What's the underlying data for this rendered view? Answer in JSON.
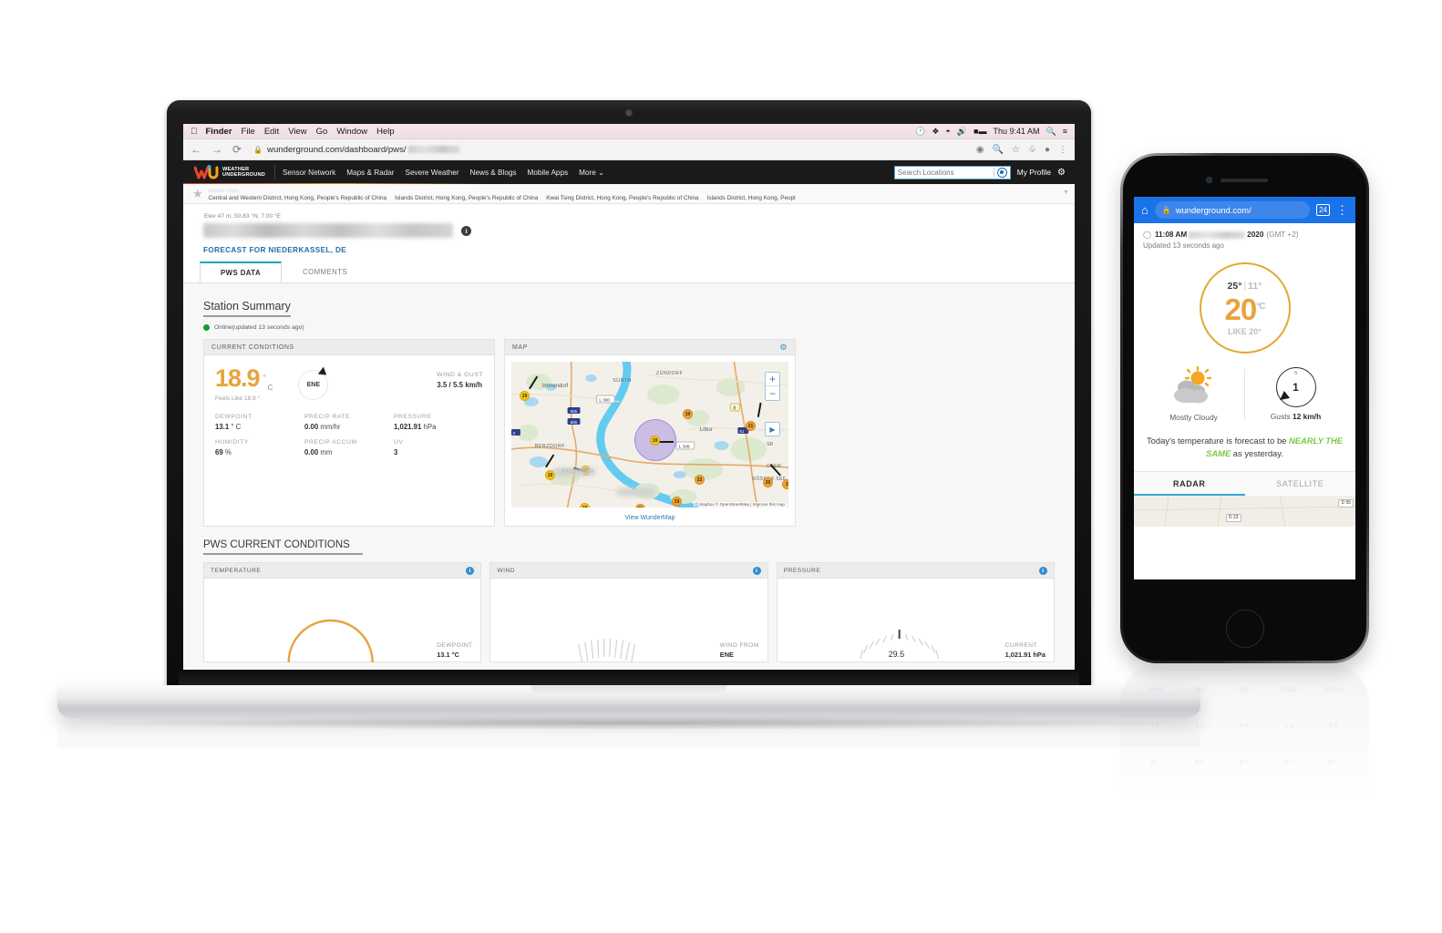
{
  "desktop": {
    "menubar": {
      "apple_icon": "apple-icon",
      "items": [
        "Finder",
        "File",
        "Edit",
        "View",
        "Go",
        "Window",
        "Help"
      ],
      "status_icons": [
        "timemachine-icon",
        "bluetooth-icon",
        "wifi-icon",
        "volume-icon",
        "battery-icon"
      ],
      "clock": "Thu 9:41 AM",
      "search_icon": "spotlight-search-icon",
      "control_center_icon": "control-center-icon"
    },
    "browser": {
      "back_icon": "back-arrow-icon",
      "forward_icon": "forward-arrow-icon",
      "reload_icon": "reload-icon",
      "lock_icon": "lock-icon",
      "url": "wunderground.com/dashboard/pws/",
      "url_redacted": true,
      "toolbar_icons": [
        "install-icon",
        "zoom-search-icon",
        "bookmark-star-icon",
        "extensions-puzzle-icon",
        "profile-avatar-icon",
        "chrome-menu-icon"
      ]
    }
  },
  "site_header": {
    "brand_line1": "WEATHER",
    "brand_line2": "UNDERGROUND",
    "nav": [
      "Sensor Network",
      "Maps & Radar",
      "Severe Weather",
      "News & Blogs",
      "Mobile Apps",
      "More"
    ],
    "more_caret": "chevron-down-icon",
    "search_placeholder": "Search Locations",
    "geolocate_icon": "crosshair-target-icon",
    "my_profile": "My Profile",
    "settings_icon": "gear-icon"
  },
  "recent_cities": {
    "star_icon": "star-icon",
    "label": "Recent Cities",
    "items": [
      "Central and Western District, Hong Kong, People's Republic of China",
      "Islands District, Hong Kong, People's Republic of China",
      "Kwai Tsing District, Hong Kong, People's Republic of China",
      "Islands District, Hong Kong, Peopl"
    ],
    "caret_icon": "chevron-down-icon"
  },
  "station": {
    "elevation": "Elev 47 m, 50.83 °N, 7.00 °E",
    "name_redacted": true,
    "info_icon": "info-icon",
    "forecast_link": "FORECAST FOR NIEDERKASSEL, DE",
    "tabs": [
      {
        "label": "PWS DATA",
        "active": true
      },
      {
        "label": "COMMENTS",
        "active": false
      }
    ]
  },
  "station_summary": {
    "title": "Station Summary",
    "status": "Online(updated 13 seconds ago)",
    "status_color": "#149e28"
  },
  "current_conditions": {
    "header": "CURRENT CONDITIONS",
    "temperature": "18.9",
    "degree_symbol": "°",
    "unit": "C",
    "feels_like": "Feels Like 18.9 °",
    "wind_dir": "ENE",
    "wind_arrow_icon": "wind-direction-arrow-icon",
    "wind_gust_label": "WIND & GUST",
    "wind_gust_value": "3.5  / 5.5 km/h",
    "metrics": [
      {
        "label": "DEWPOINT",
        "value": "13.1",
        "unit": "° C"
      },
      {
        "label": "PRECIP RATE",
        "value": "0.00",
        "unit": "mm/hr"
      },
      {
        "label": "PRESSURE",
        "value": "1,021.91",
        "unit": "hPa"
      },
      {
        "label": "HUMIDITY",
        "value": "69",
        "unit": "%"
      },
      {
        "label": "PRECIP ACCUM",
        "value": "0.00",
        "unit": "mm"
      },
      {
        "label": "UV",
        "value": "3",
        "unit": ""
      }
    ]
  },
  "map_card": {
    "header": "MAP",
    "settings_icon": "gear-icon",
    "zoom_in": "+",
    "zoom_out": "−",
    "play_icon": "play-icon",
    "attribution": "© Mapbox © OpenStreetMap | Improve this map",
    "footer_link": "View WunderMap",
    "place_labels": [
      "Immendorf",
      "SÜRTH",
      "ZÜNDORF",
      "Libur",
      "BERZDORF",
      "KELDENICH",
      "OBER",
      "RÖSRER SEE"
    ],
    "road_shields": [
      "L 300",
      "555",
      "555",
      "8",
      "L 349",
      "51",
      "3"
    ],
    "station_markers": [
      "19",
      "19",
      "19",
      "21",
      "19",
      "19",
      "22",
      "19",
      "20",
      "19",
      "21",
      "19"
    ],
    "selected_marker": "19"
  },
  "pws_conditions": {
    "title": "PWS CURRENT CONDITIONS",
    "cards": [
      {
        "header": "TEMPERATURE",
        "info_icon": "info-icon",
        "side_label": "DEWPOINT",
        "side_value": "13.1 °C"
      },
      {
        "header": "WIND",
        "info_icon": "info-icon",
        "side_label": "WIND FROM",
        "side_value": "ENE",
        "gauge_value": ""
      },
      {
        "header": "PRESSURE",
        "info_icon": "info-icon",
        "side_label": "CURRENT",
        "side_value": "1,021.91 hPa",
        "gauge_value": "29.5"
      }
    ]
  },
  "phone": {
    "browser": {
      "home_icon": "home-icon",
      "lock_icon": "lock-icon",
      "url": "wunderground.com/",
      "tab_count": "24",
      "menu_icon": "overflow-menu-icon",
      "bar_color": "#1a73e8"
    },
    "timestamp": {
      "clock_icon": "clock-icon",
      "time": "11:08 AM",
      "date_redacted": true,
      "year": "2020",
      "timezone": "(GMT +2)",
      "updated": "Updated 13 seconds ago"
    },
    "temp_circle": {
      "high": "25°",
      "separator": "|",
      "low": "11°",
      "current": "20",
      "unit": "°C",
      "like_label": "LIKE",
      "like_value": "20°",
      "ring_color": "#e3a92e"
    },
    "condition": {
      "icon": "mostly-cloudy-icon",
      "label": "Mostly Cloudy"
    },
    "gusts": {
      "dial_north": "N",
      "dial_value": "1",
      "arrow_icon": "wind-direction-arrow-icon",
      "label_prefix": "Gusts ",
      "label_value": "12 km/h"
    },
    "forecast_text_before": "Today's temperature is forecast to be ",
    "forecast_text_highlight": "NEARLY THE SAME",
    "forecast_text_after": " as yesterday.",
    "highlight_color": "#7ac943",
    "map_tabs": [
      {
        "label": "RADAR",
        "active": true
      },
      {
        "label": "SATELLITE",
        "active": false
      }
    ],
    "map_shields": [
      "D 23",
      "D 55"
    ]
  }
}
